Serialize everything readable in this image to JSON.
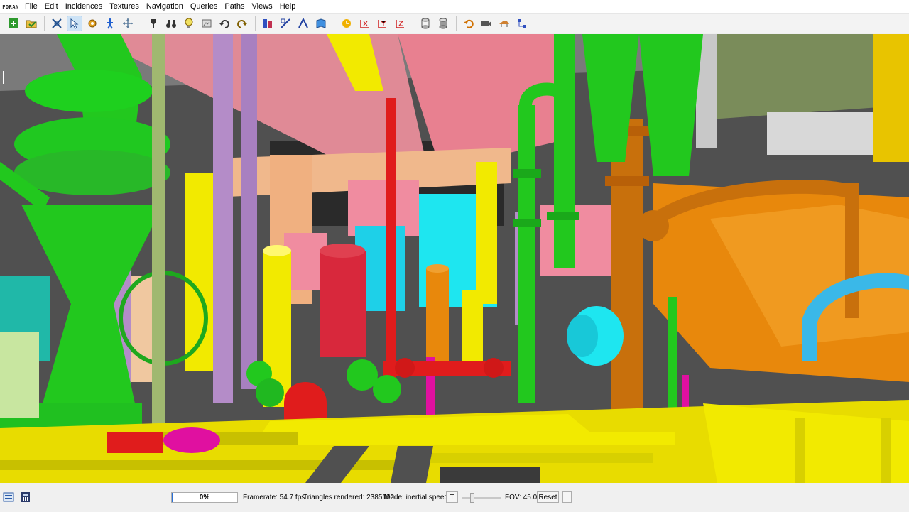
{
  "app": {
    "logo": "FORAN"
  },
  "menu": [
    "File",
    "Edit",
    "Incidences",
    "Textures",
    "Navigation",
    "Queries",
    "Paths",
    "Views",
    "Help"
  ],
  "toolbar": {
    "icons": [
      "new-session-icon",
      "open-icon",
      "select-all-icon",
      "select-icon",
      "settings-gear-icon",
      "walk-person-icon",
      "orbit-icon",
      "flashlight-icon",
      "binoculars-icon",
      "lightbulb-icon",
      "screenshot-icon",
      "undo-view-icon",
      "redo-view-icon",
      "distance-icon",
      "dimension-icon",
      "angle-icon",
      "book-icon",
      "rotate-icon",
      "axis-x-icon",
      "axis-y-icon",
      "axis-z-icon",
      "cylinder-icon",
      "cylinder-solid-icon",
      "undo-icon",
      "camera-icon",
      "plane-icon",
      "network-icon"
    ]
  },
  "status": {
    "progress_label": "0%",
    "progress_value": 0,
    "framerate": "Framerate: 54.7 fps",
    "triangles": "Triangles rendered: 2385192",
    "mode": "Mode: inertial speed",
    "t_label": "T",
    "fov": "FOV: 45.0",
    "reset": "Reset",
    "i_label": "I"
  },
  "colors": {
    "pipe_green": "#22c81e",
    "pipe_yellow": "#f2ea00",
    "pipe_red": "#e01c1c",
    "pipe_orange": "#e8880c",
    "pipe_cyan": "#1ee6f0",
    "duct_pink": "#e87c8c",
    "pipe_purple": "#b48cc8",
    "beam_tan": "#f0b88c"
  }
}
